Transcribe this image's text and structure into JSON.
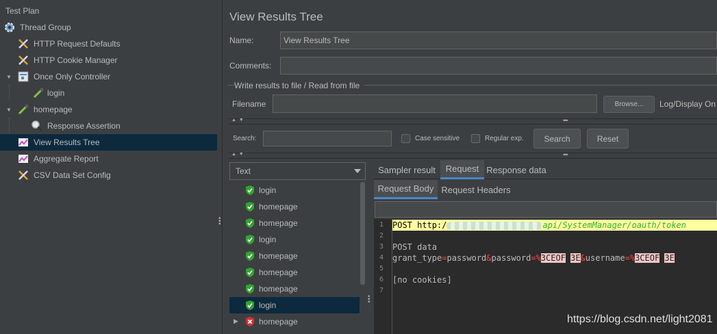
{
  "tree": {
    "items": [
      {
        "label": "Test Plan",
        "icon": "test-plan-icon"
      },
      {
        "label": "Thread Group",
        "icon": "gear-icon"
      },
      {
        "label": "HTTP Request Defaults",
        "icon": "wrench-icon"
      },
      {
        "label": "HTTP Cookie Manager",
        "icon": "wrench-icon"
      },
      {
        "label": "Once Only Controller",
        "icon": "controller-icon"
      },
      {
        "label": "login",
        "icon": "pipette-icon"
      },
      {
        "label": "homepage",
        "icon": "pipette-icon"
      },
      {
        "label": "Response Assertion",
        "icon": "magnifier-icon"
      },
      {
        "label": "View Results Tree",
        "icon": "chart-icon"
      },
      {
        "label": "Aggregate Report",
        "icon": "chart-icon"
      },
      {
        "label": "CSV Data Set Config",
        "icon": "wrench-icon"
      }
    ]
  },
  "panel": {
    "title": "View Results Tree",
    "name_label": "Name:",
    "name_value": "View Results Tree",
    "comments_label": "Comments:",
    "write_results_title": "Write results to file / Read from file",
    "filename_label": "Filename",
    "browse_label": "Browse...",
    "log_display_label": "Log/Display On"
  },
  "search": {
    "label": "Search:",
    "case_sensitive": "Case sensitive",
    "regular_exp": "Regular exp.",
    "search_button": "Search",
    "reset_button": "Reset"
  },
  "results": {
    "renderer": "Text",
    "items": [
      {
        "label": "login",
        "status": "success"
      },
      {
        "label": "homepage",
        "status": "success"
      },
      {
        "label": "homepage",
        "status": "success"
      },
      {
        "label": "login",
        "status": "success"
      },
      {
        "label": "homepage",
        "status": "success"
      },
      {
        "label": "homepage",
        "status": "success"
      },
      {
        "label": "homepage",
        "status": "success"
      },
      {
        "label": "login",
        "status": "success"
      },
      {
        "label": "homepage",
        "status": "error"
      }
    ]
  },
  "tabs": [
    "Sampler result",
    "Request",
    "Response data"
  ],
  "subtabs": [
    "Request Body",
    "Request Headers"
  ],
  "editor": {
    "line_numbers": [
      "1",
      "2",
      "3",
      "4",
      "5",
      "6",
      "7"
    ],
    "line1_prefix": "POST http:/",
    "line1_url": "api/SystemManager/oauth/token",
    "line3": "POST data",
    "line4_a": "grant_type",
    "line4_b": "password",
    "line4_c": "password",
    "line4_d": "3CEOF",
    "line4_e": "3E",
    "line4_f": "username",
    "line4_g": "3CEOF",
    "line4_h": "3E",
    "line6": "[no cookies]"
  },
  "watermark": "https://blog.csdn.net/light2081",
  "colors": {
    "accent": "#4a88c7",
    "selection": "#0d293e",
    "background": "#3c3f41"
  }
}
